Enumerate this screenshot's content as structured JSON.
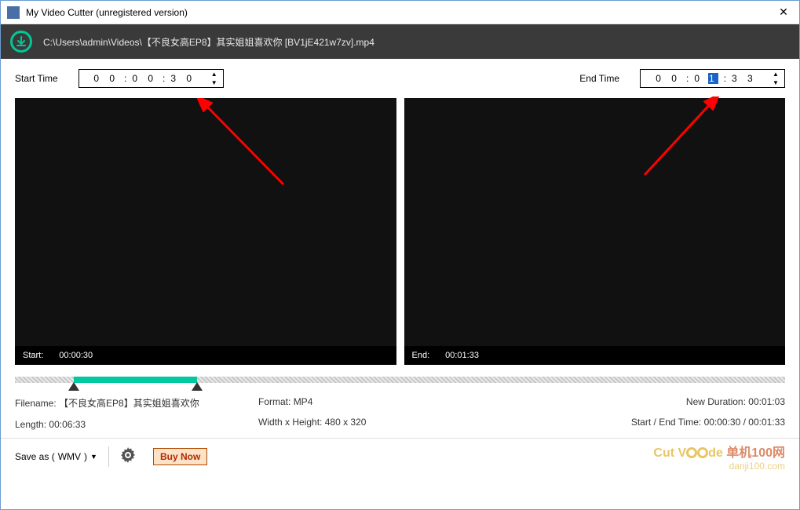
{
  "window": {
    "title": "My Video Cutter (unregistered version)"
  },
  "path": "C:\\Users\\admin\\Videos\\【不良女高EP8】其实姐姐喜欢你 [BV1jE421w7zv].mp4",
  "start": {
    "label": "Start Time",
    "hh": "0 0",
    "mm": "0 0",
    "ss": "3 0",
    "panel_label": "Start:",
    "panel_time": "00:00:30"
  },
  "end": {
    "label": "End Time",
    "hh": "0 0",
    "mm_a": "0 ",
    "mm_sel": "1",
    "ss": "3 3",
    "panel_label": "End:",
    "panel_time": "00:01:33"
  },
  "seek": {
    "start_pct": 7.6,
    "end_pct": 23.6
  },
  "info": {
    "filename_label": "Filename:",
    "filename": "【不良女高EP8】其实姐姐喜欢你",
    "length_label": "Length:",
    "length": "00:06:33",
    "format_label": "Format:",
    "format": "MP4",
    "wh_label": "Width x Height:",
    "wh": "480 x 320",
    "newdur_label": "New Duration:",
    "newdur": "00:01:03",
    "setime_label": "Start / End Time:",
    "setime": "00:00:30 / 00:01:33"
  },
  "footer": {
    "saveas_prefix": "Save as ( ",
    "saveas_fmt": "WMV",
    "saveas_suffix": " )",
    "buy": "Buy Now"
  },
  "watermark": {
    "line1": "Cut V",
    "line1b": "de",
    "line2": "danji100.com"
  }
}
